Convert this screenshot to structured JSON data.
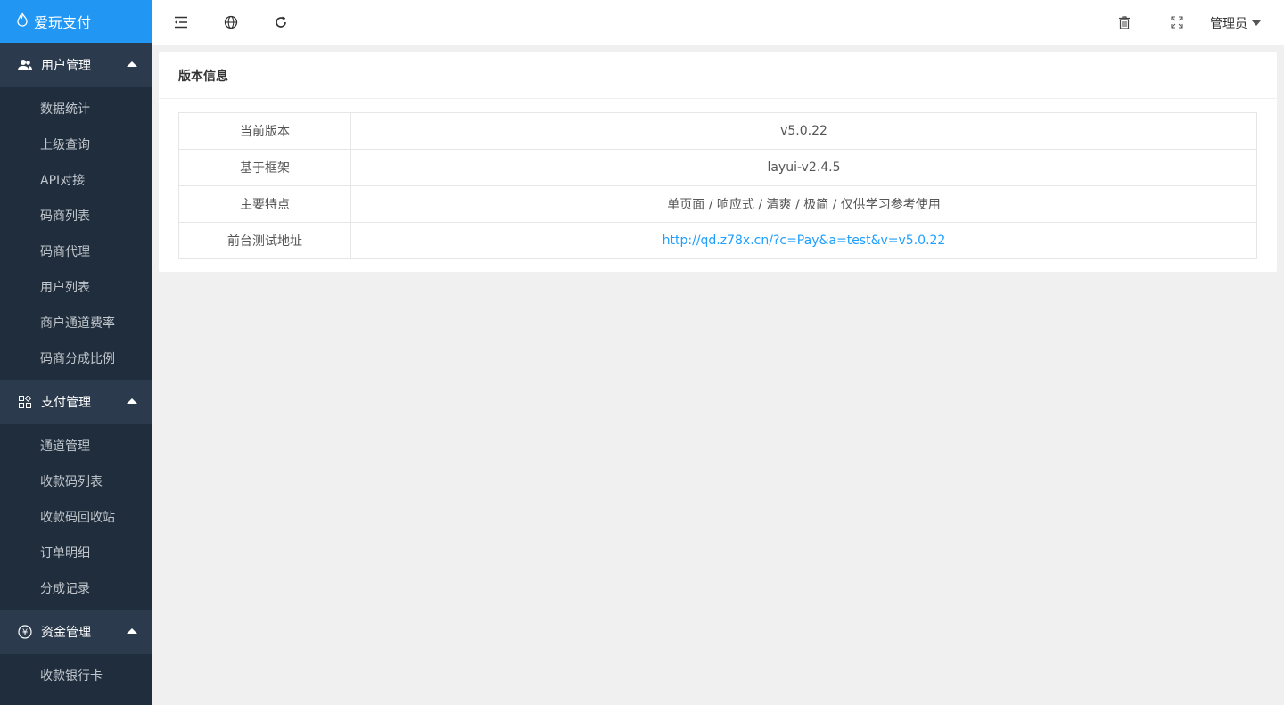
{
  "app": {
    "title": "爱玩支付"
  },
  "sidebar": {
    "groups": [
      {
        "label": "用户管理",
        "icon": "users-icon",
        "items": [
          "数据统计",
          "上级查询",
          "API对接",
          "码商列表",
          "码商代理",
          "用户列表",
          "商户通道费率",
          "码商分成比例"
        ]
      },
      {
        "label": "支付管理",
        "icon": "apps-icon",
        "items": [
          "通道管理",
          "收款码列表",
          "收款码回收站",
          "订单明细",
          "分成记录"
        ]
      },
      {
        "label": "资金管理",
        "icon": "yen-icon",
        "items": [
          "收款银行卡"
        ]
      }
    ]
  },
  "topbar": {
    "icons": [
      "menu-collapse-icon",
      "globe-icon",
      "refresh-icon",
      "trash-icon",
      "fullscreen-icon"
    ],
    "user": "管理员"
  },
  "card": {
    "title": "版本信息",
    "rows": [
      {
        "key": "当前版本",
        "value": "v5.0.22"
      },
      {
        "key": "基于框架",
        "value": "layui-v2.4.5"
      },
      {
        "key": "主要特点",
        "value": "单页面 / 响应式 / 清爽 / 极简 / 仅供学习参考使用"
      },
      {
        "key": "前台测试地址",
        "value": "http://qd.z78x.cn/?c=Pay&a=test&v=v5.0.22",
        "link": true
      }
    ]
  },
  "colors": {
    "brand": "#2196f3",
    "sidebar": "#1f2d3d",
    "link": "#1e9fff"
  }
}
